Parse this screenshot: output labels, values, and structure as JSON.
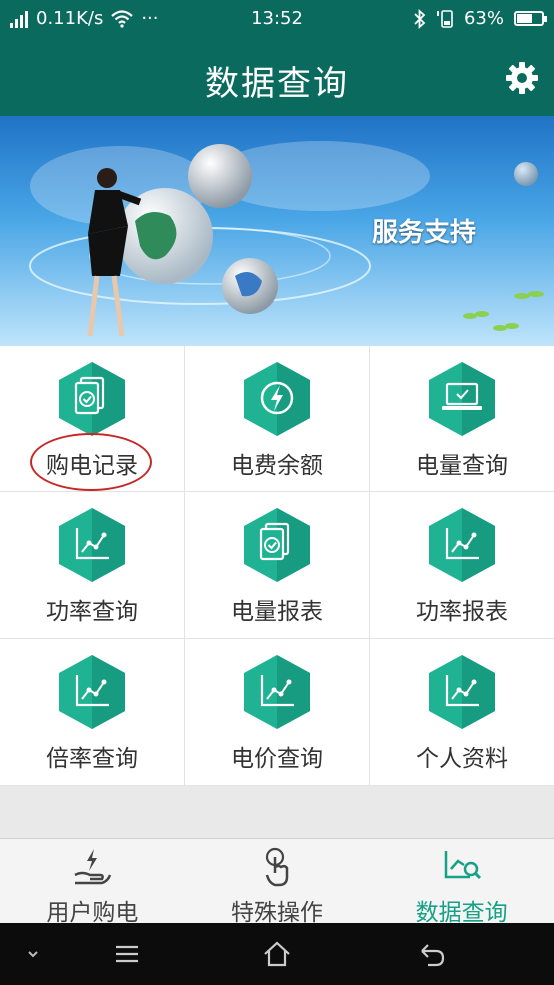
{
  "status_bar": {
    "speed": "0.11K/s",
    "more": "···",
    "time": "13:52",
    "battery": "63%",
    "battery_level": 0.63
  },
  "header": {
    "title": "数据查询",
    "settings_icon": "gear-icon"
  },
  "banner": {
    "text": "服务支持"
  },
  "grid": {
    "items": [
      {
        "label": "购电记录",
        "icon": "documents-check-icon"
      },
      {
        "label": "电费余额",
        "icon": "lightning-circle-icon"
      },
      {
        "label": "电量查询",
        "icon": "laptop-icon"
      },
      {
        "label": "功率查询",
        "icon": "line-chart-icon"
      },
      {
        "label": "电量报表",
        "icon": "documents-check-icon"
      },
      {
        "label": "功率报表",
        "icon": "line-chart-icon"
      },
      {
        "label": "倍率查询",
        "icon": "line-chart-icon"
      },
      {
        "label": "电价查询",
        "icon": "line-chart-icon"
      },
      {
        "label": "个人资料",
        "icon": "line-chart-icon"
      }
    ]
  },
  "tabs": [
    {
      "label": "用户购电",
      "icon": "hand-lightning-icon"
    },
    {
      "label": "特殊操作",
      "icon": "touch-hand-icon"
    },
    {
      "label": "数据查询",
      "icon": "chart-search-icon",
      "active": true
    }
  ],
  "colors": {
    "header": "#0b6a5e",
    "icon_hex": "#1fb394",
    "active_tab": "#16a085",
    "highlight": "#c62828"
  }
}
